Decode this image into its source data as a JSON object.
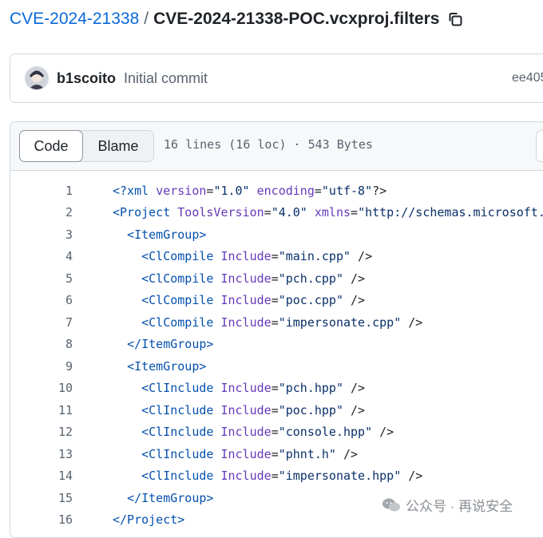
{
  "breadcrumb": {
    "repo": "CVE-2024-21338",
    "separator": "/",
    "file": "CVE-2024-21338-POC.vcxproj.filters"
  },
  "commit": {
    "author": "b1scoito",
    "message": "Initial commit",
    "sha": "ee405"
  },
  "file_header": {
    "code_tab": "Code",
    "blame_tab": "Blame",
    "info": "16 lines (16 loc) · 543 Bytes"
  },
  "code_lines": [
    {
      "n": "1",
      "parts": [
        {
          "t": "tag",
          "s": "<?xml "
        },
        {
          "t": "attr",
          "s": "version"
        },
        {
          "t": "plain",
          "s": "="
        },
        {
          "t": "str",
          "s": "\"1.0\""
        },
        {
          "t": "plain",
          "s": " "
        },
        {
          "t": "attr",
          "s": "encoding"
        },
        {
          "t": "plain",
          "s": "="
        },
        {
          "t": "str",
          "s": "\"utf-8\""
        },
        {
          "t": "plain",
          "s": "?>"
        }
      ]
    },
    {
      "n": "2",
      "parts": [
        {
          "t": "tag",
          "s": "<Project "
        },
        {
          "t": "attr",
          "s": "ToolsVersion"
        },
        {
          "t": "plain",
          "s": "="
        },
        {
          "t": "str",
          "s": "\"4.0\""
        },
        {
          "t": "plain",
          "s": " "
        },
        {
          "t": "attr",
          "s": "xmlns"
        },
        {
          "t": "plain",
          "s": "="
        },
        {
          "t": "str",
          "s": "\"http://schemas.microsoft."
        }
      ]
    },
    {
      "n": "3",
      "parts": [
        {
          "t": "plain",
          "s": "  "
        },
        {
          "t": "tag",
          "s": "<ItemGroup>"
        }
      ]
    },
    {
      "n": "4",
      "parts": [
        {
          "t": "plain",
          "s": "    "
        },
        {
          "t": "tag",
          "s": "<ClCompile "
        },
        {
          "t": "attr",
          "s": "Include"
        },
        {
          "t": "plain",
          "s": "="
        },
        {
          "t": "str",
          "s": "\"main.cpp\""
        },
        {
          "t": "plain",
          "s": " />"
        }
      ]
    },
    {
      "n": "5",
      "parts": [
        {
          "t": "plain",
          "s": "    "
        },
        {
          "t": "tag",
          "s": "<ClCompile "
        },
        {
          "t": "attr",
          "s": "Include"
        },
        {
          "t": "plain",
          "s": "="
        },
        {
          "t": "str",
          "s": "\"pch.cpp\""
        },
        {
          "t": "plain",
          "s": " />"
        }
      ]
    },
    {
      "n": "6",
      "parts": [
        {
          "t": "plain",
          "s": "    "
        },
        {
          "t": "tag",
          "s": "<ClCompile "
        },
        {
          "t": "attr",
          "s": "Include"
        },
        {
          "t": "plain",
          "s": "="
        },
        {
          "t": "str",
          "s": "\"poc.cpp\""
        },
        {
          "t": "plain",
          "s": " />"
        }
      ]
    },
    {
      "n": "7",
      "parts": [
        {
          "t": "plain",
          "s": "    "
        },
        {
          "t": "tag",
          "s": "<ClCompile "
        },
        {
          "t": "attr",
          "s": "Include"
        },
        {
          "t": "plain",
          "s": "="
        },
        {
          "t": "str",
          "s": "\"impersonate.cpp\""
        },
        {
          "t": "plain",
          "s": " />"
        }
      ]
    },
    {
      "n": "8",
      "parts": [
        {
          "t": "plain",
          "s": "  "
        },
        {
          "t": "tag",
          "s": "</ItemGroup>"
        }
      ]
    },
    {
      "n": "9",
      "parts": [
        {
          "t": "plain",
          "s": "  "
        },
        {
          "t": "tag",
          "s": "<ItemGroup>"
        }
      ]
    },
    {
      "n": "10",
      "parts": [
        {
          "t": "plain",
          "s": "    "
        },
        {
          "t": "tag",
          "s": "<ClInclude "
        },
        {
          "t": "attr",
          "s": "Include"
        },
        {
          "t": "plain",
          "s": "="
        },
        {
          "t": "str",
          "s": "\"pch.hpp\""
        },
        {
          "t": "plain",
          "s": " />"
        }
      ]
    },
    {
      "n": "11",
      "parts": [
        {
          "t": "plain",
          "s": "    "
        },
        {
          "t": "tag",
          "s": "<ClInclude "
        },
        {
          "t": "attr",
          "s": "Include"
        },
        {
          "t": "plain",
          "s": "="
        },
        {
          "t": "str",
          "s": "\"poc.hpp\""
        },
        {
          "t": "plain",
          "s": " />"
        }
      ]
    },
    {
      "n": "12",
      "parts": [
        {
          "t": "plain",
          "s": "    "
        },
        {
          "t": "tag",
          "s": "<ClInclude "
        },
        {
          "t": "attr",
          "s": "Include"
        },
        {
          "t": "plain",
          "s": "="
        },
        {
          "t": "str",
          "s": "\"console.hpp\""
        },
        {
          "t": "plain",
          "s": " />"
        }
      ]
    },
    {
      "n": "13",
      "parts": [
        {
          "t": "plain",
          "s": "    "
        },
        {
          "t": "tag",
          "s": "<ClInclude "
        },
        {
          "t": "attr",
          "s": "Include"
        },
        {
          "t": "plain",
          "s": "="
        },
        {
          "t": "str",
          "s": "\"phnt.h\""
        },
        {
          "t": "plain",
          "s": " />"
        }
      ]
    },
    {
      "n": "14",
      "parts": [
        {
          "t": "plain",
          "s": "    "
        },
        {
          "t": "tag",
          "s": "<ClInclude "
        },
        {
          "t": "attr",
          "s": "Include"
        },
        {
          "t": "plain",
          "s": "="
        },
        {
          "t": "str",
          "s": "\"impersonate.hpp\""
        },
        {
          "t": "plain",
          "s": " />"
        }
      ]
    },
    {
      "n": "15",
      "parts": [
        {
          "t": "plain",
          "s": "  "
        },
        {
          "t": "tag",
          "s": "</ItemGroup>"
        }
      ]
    },
    {
      "n": "16",
      "parts": [
        {
          "t": "tag",
          "s": "</Project>"
        }
      ]
    }
  ],
  "watermark": {
    "text": "公众号 · 再说安全"
  },
  "icons": {
    "copy": "copy-icon",
    "avatar": "avatar",
    "watermark": "wechat-icon"
  },
  "colors": {
    "link": "#0969da",
    "tag": "#0550ae",
    "attr": "#6639ba",
    "string": "#0a3069"
  }
}
